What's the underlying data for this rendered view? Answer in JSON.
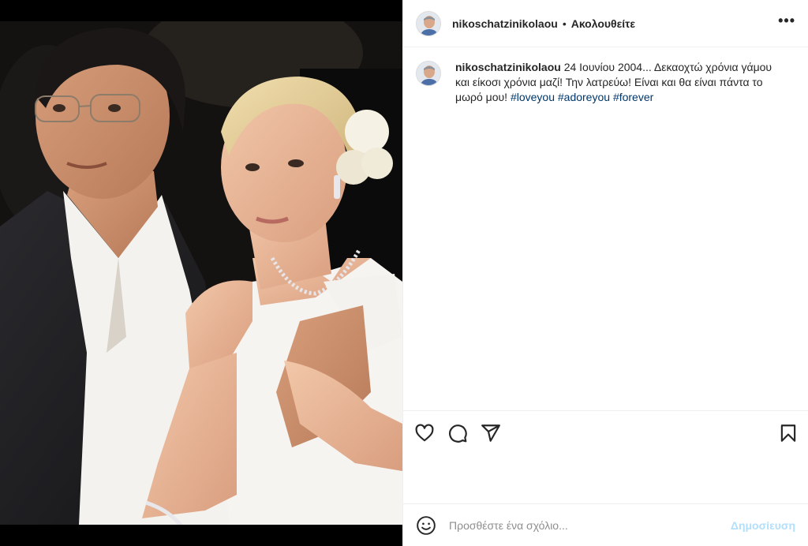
{
  "post": {
    "username": "nikoschatzinikolaou",
    "follow_separator": "•",
    "follow_status": "Ακολουθείτε",
    "more_label": "•••"
  },
  "caption": {
    "username": "nikoschatzinikolaou",
    "text": " 24 Ιουνίου 2004... Δεκαοχτώ χρόνια γάμου και είκοσι χρόνια μαζί! Την λατρεύω! Είναι και θα είναι πάντα το μωρό μου! ",
    "hashtags": [
      "#loveyou",
      "#adoreyou",
      "#forever"
    ]
  },
  "actions": {
    "icons": [
      "heart-icon",
      "comment-icon",
      "share-icon",
      "bookmark-icon"
    ]
  },
  "comment_bar": {
    "placeholder": "Προσθέστε ένα σχόλιο...",
    "post_label": "Δημοσίευση",
    "icon": "emoji-icon"
  },
  "colors": {
    "text": "#262626",
    "hashtag": "#00376b",
    "border": "#efefef",
    "post_disabled": "#b2dffc",
    "placeholder": "#8e8e8e"
  }
}
